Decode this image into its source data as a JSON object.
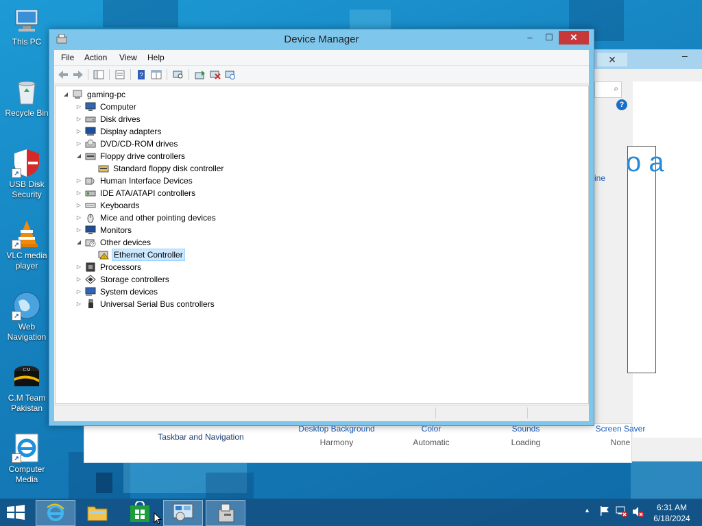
{
  "desktop": {
    "icons": [
      {
        "label": "This PC",
        "icon": "computer-icon"
      },
      {
        "label": "Recycle Bin",
        "icon": "recycle-bin-icon"
      },
      {
        "label": "USB Disk Security",
        "icon": "usb-disk-security-icon"
      },
      {
        "label": "VLC media player",
        "icon": "vlc-icon"
      },
      {
        "label": "Web Navigation",
        "icon": "globe-icon"
      },
      {
        "label": "C.M Team Pakistan",
        "icon": "cm-team-icon"
      },
      {
        "label": "Computer Media",
        "icon": "internet-explorer-icon"
      }
    ]
  },
  "background_window": {
    "big_text": "o a",
    "link_text": "ine",
    "bottom_items": [
      {
        "title": "Taskbar and Navigation",
        "value": ""
      },
      {
        "title": "Desktop Background",
        "value": "Harmony"
      },
      {
        "title": "Color",
        "value": "Automatic"
      },
      {
        "title": "Sounds",
        "value": "Loading"
      },
      {
        "title": "Screen Saver",
        "value": "None"
      }
    ]
  },
  "device_manager": {
    "title": "Device Manager",
    "menu": [
      "File",
      "Action",
      "View",
      "Help"
    ],
    "tree": {
      "root": "gaming-pc",
      "items": [
        {
          "label": "Computer",
          "expanded": false,
          "icon": "computer-icon"
        },
        {
          "label": "Disk drives",
          "expanded": false,
          "icon": "disk-drive-icon"
        },
        {
          "label": "Display adapters",
          "expanded": false,
          "icon": "display-adapter-icon"
        },
        {
          "label": "DVD/CD-ROM drives",
          "expanded": false,
          "icon": "dvd-drive-icon"
        },
        {
          "label": "Floppy drive controllers",
          "expanded": true,
          "icon": "floppy-controller-icon",
          "children": [
            {
              "label": "Standard floppy disk controller",
              "icon": "floppy-controller-icon"
            }
          ]
        },
        {
          "label": "Human Interface Devices",
          "expanded": false,
          "icon": "hid-icon"
        },
        {
          "label": "IDE ATA/ATAPI controllers",
          "expanded": false,
          "icon": "ide-controller-icon"
        },
        {
          "label": "Keyboards",
          "expanded": false,
          "icon": "keyboard-icon"
        },
        {
          "label": "Mice and other pointing devices",
          "expanded": false,
          "icon": "mouse-icon"
        },
        {
          "label": "Monitors",
          "expanded": false,
          "icon": "monitor-icon"
        },
        {
          "label": "Other devices",
          "expanded": true,
          "icon": "other-devices-icon",
          "children": [
            {
              "label": "Ethernet Controller",
              "icon": "warning-device-icon",
              "selected": true
            }
          ]
        },
        {
          "label": "Processors",
          "expanded": false,
          "icon": "processor-icon"
        },
        {
          "label": "Storage controllers",
          "expanded": false,
          "icon": "storage-controller-icon"
        },
        {
          "label": "System devices",
          "expanded": false,
          "icon": "system-devices-icon"
        },
        {
          "label": "Universal Serial Bus controllers",
          "expanded": false,
          "icon": "usb-icon"
        }
      ]
    }
  },
  "taskbar": {
    "clock_time": "6:31 AM",
    "clock_date": "6/18/2024"
  }
}
